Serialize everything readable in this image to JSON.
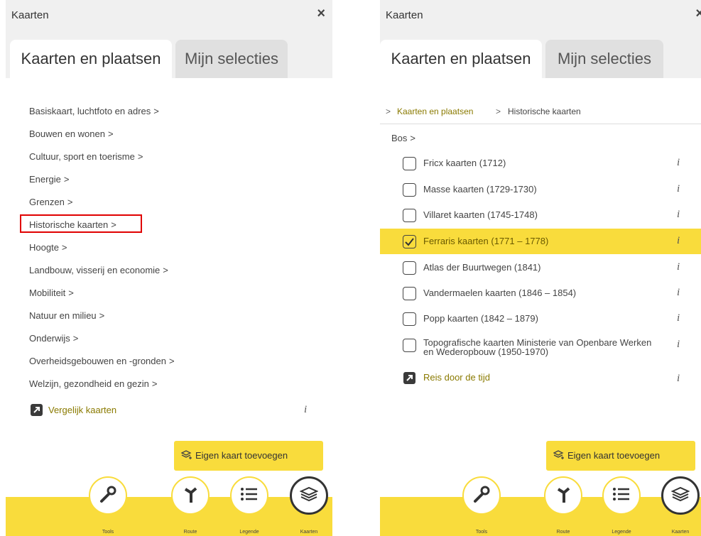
{
  "left": {
    "title": "Kaarten",
    "tabs": [
      {
        "label": "Kaarten en plaatsen"
      },
      {
        "label": "Mijn selecties"
      }
    ],
    "categories": [
      {
        "label": "Basiskaart, luchtfoto en adres"
      },
      {
        "label": "Bouwen en wonen"
      },
      {
        "label": "Cultuur, sport en toerisme"
      },
      {
        "label": "Energie"
      },
      {
        "label": "Grenzen"
      },
      {
        "label": "Historische kaarten"
      },
      {
        "label": "Hoogte"
      },
      {
        "label": "Landbouw, visserij en economie"
      },
      {
        "label": "Mobiliteit"
      },
      {
        "label": "Natuur en milieu"
      },
      {
        "label": "Onderwijs"
      },
      {
        "label": "Overheidsgebouwen en -gronden"
      },
      {
        "label": "Welzijn, gezondheid en gezin"
      }
    ],
    "chevron": ">",
    "compare_link": "Vergelijk kaarten",
    "info": "i",
    "add_button": "Eigen kaart toevoegen"
  },
  "right": {
    "title": "Kaarten",
    "tabs": [
      {
        "label": "Kaarten en plaatsen"
      },
      {
        "label": "Mijn selecties"
      }
    ],
    "breadcrumb": {
      "sep": ">",
      "root": "Kaarten en plaatsen",
      "current": "Historische kaarten"
    },
    "subcategory": "Bos",
    "maps": [
      {
        "label": "Fricx kaarten (1712)",
        "checked": false
      },
      {
        "label": "Masse kaarten (1729-1730)",
        "checked": false
      },
      {
        "label": "Villaret kaarten (1745-1748)",
        "checked": false
      },
      {
        "label": "Ferraris kaarten (1771 – 1778)",
        "checked": true
      },
      {
        "label": "Atlas der Buurtwegen (1841)",
        "checked": false
      },
      {
        "label": "Vandermaelen kaarten (1846 – 1854)",
        "checked": false
      },
      {
        "label": "Popp kaarten (1842 – 1879)",
        "checked": false
      },
      {
        "label": "Topografische kaarten Ministerie van Openbare Werken en Wederopbouw (1950-1970)",
        "checked": false
      }
    ],
    "time_link": "Reis door de tijd",
    "info": "i",
    "add_button": "Eigen kaart toevoegen"
  },
  "nav": [
    {
      "label": "Tools",
      "icon": "wrench-icon"
    },
    {
      "label": "Route",
      "icon": "route-icon"
    },
    {
      "label": "Legende",
      "icon": "list-icon"
    },
    {
      "label": "Kaarten",
      "icon": "layers-icon"
    }
  ],
  "colors": {
    "accent": "#f9dc3c",
    "link": "#8a7a00",
    "highlight_box": "#e00000"
  }
}
